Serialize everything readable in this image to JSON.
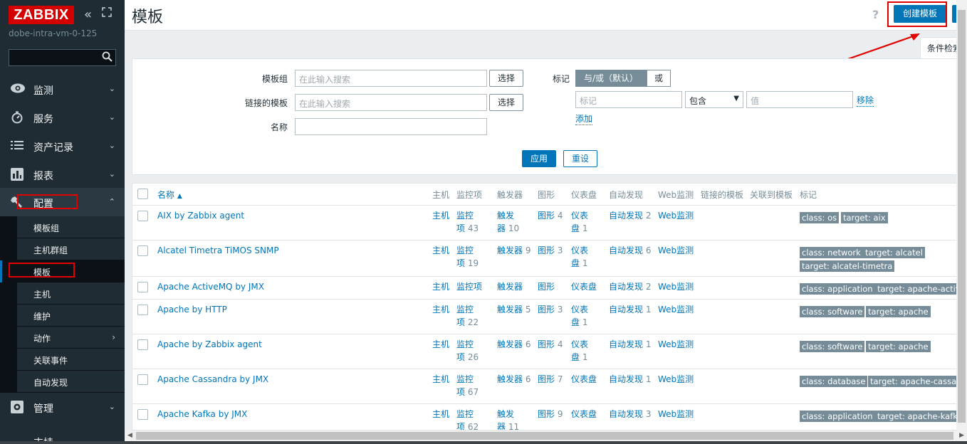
{
  "sidebar": {
    "logo": "ZABBIX",
    "server_name": "dobe-intra-vm-0-125",
    "menu": [
      {
        "label": "监测",
        "icon": "eye-icon"
      },
      {
        "label": "服务",
        "icon": "clock-icon"
      },
      {
        "label": "资产记录",
        "icon": "list-icon"
      },
      {
        "label": "报表",
        "icon": "bar-chart-icon"
      },
      {
        "label": "配置",
        "icon": "wrench-icon"
      },
      {
        "label": "管理",
        "icon": "gear-icon"
      },
      {
        "label": "支持",
        "icon": "info-icon"
      }
    ],
    "submenu": [
      "模板组",
      "主机群组",
      "模板",
      "主机",
      "维护",
      "动作",
      "关联事件",
      "自动发现"
    ]
  },
  "header": {
    "title": "模板",
    "create_button": "创建模板"
  },
  "filter": {
    "tab_label": "条件检索",
    "template_group_label": "模板组",
    "linked_templates_label": "链接的模板",
    "name_label": "名称",
    "placeholder": "在此输入搜索",
    "select_button": "选择",
    "tags_label": "标记",
    "tag_mode_and_or": "与/或（默认）",
    "tag_mode_or": "或",
    "tag_placeholder": "标记",
    "operator_value": "包含",
    "value_placeholder": "值",
    "remove_link": "移除",
    "add_link": "添加",
    "apply_button": "应用",
    "reset_button": "重设"
  },
  "table": {
    "headers": {
      "name": "名称",
      "hosts": "主机",
      "items": "监控项",
      "triggers": "触发器",
      "graphs": "图形",
      "dashboards": "仪表盘",
      "discovery": "自动发现",
      "web": "Web监测",
      "linked": "链接的模板",
      "linked_to": "关联到模板",
      "tags": "标记"
    },
    "cells": {
      "hosts": "主机",
      "items": "监控项",
      "items_a": "监控",
      "items_b": "项",
      "triggers": "触发器",
      "triggers_a": "触发",
      "triggers_b": "器",
      "graphs": "图形",
      "dashboards": "仪表盘",
      "dash_a": "仪表",
      "dash_b": "盘",
      "discovery": "自动发现",
      "web": "Web监测"
    },
    "rows": [
      {
        "name": "AIX by Zabbix agent",
        "items": "43",
        "triggers": "10",
        "graphs": "4",
        "dashboards": "1",
        "discovery": "2",
        "tags": [
          "class: os",
          "target: aix"
        ]
      },
      {
        "name": "Alcatel Timetra TiMOS SNMP",
        "items": "19",
        "triggers": "9",
        "graphs": "3",
        "dashboards": "1",
        "discovery": "6",
        "tags": [
          "class: network",
          "target: alcatel",
          "target: alcatel-timetra"
        ]
      },
      {
        "name": "Apache ActiveMQ by JMX",
        "items": "",
        "triggers": "",
        "graphs": "",
        "dashboards": "",
        "discovery": "2",
        "tags": [
          "class: application",
          "target: apache-activemq"
        ]
      },
      {
        "name": "Apache by HTTP",
        "items": "22",
        "triggers": "5",
        "graphs": "3",
        "dashboards": "1",
        "discovery": "1",
        "tags": [
          "class: software",
          "target: apache"
        ]
      },
      {
        "name": "Apache by Zabbix agent",
        "items": "26",
        "triggers": "6",
        "graphs": "4",
        "dashboards": "1",
        "discovery": "1",
        "tags": [
          "class: software",
          "target: apache"
        ]
      },
      {
        "name": "Apache Cassandra by JMX",
        "items": "67",
        "triggers": "6",
        "graphs": "7",
        "dashboards": "",
        "discovery": "1",
        "tags": [
          "class: database",
          "target: apache-cassa..."
        ]
      },
      {
        "name": "Apache Kafka by JMX",
        "items": "62",
        "triggers": "11",
        "graphs": "9",
        "dashboards": "",
        "discovery": "3",
        "tags": [
          "class: application",
          "target: apache-kafka"
        ]
      }
    ]
  },
  "colors": {
    "sidebar_bg": "#1f2c33",
    "accent": "#0275b8",
    "tag_bg": "#768d99",
    "annotation_red": "#e00000",
    "logo_red": "#d40000"
  }
}
